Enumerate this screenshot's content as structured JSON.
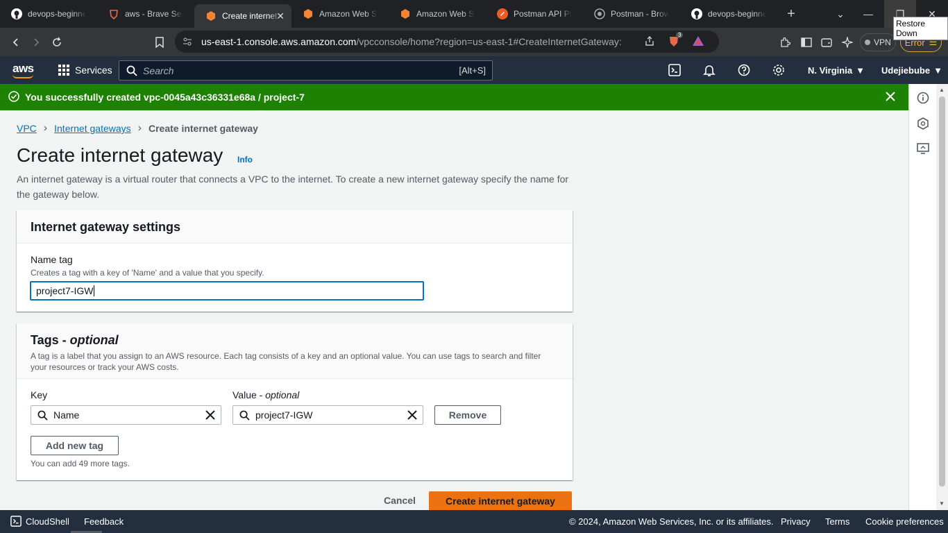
{
  "browser": {
    "tabs": [
      {
        "label": "devops-beginner",
        "icon": "github-icon"
      },
      {
        "label": "aws - Brave Search",
        "icon": "brave-icon"
      },
      {
        "label": "Create internet gateway",
        "icon": "aws-cube-icon",
        "active": true
      },
      {
        "label": "Amazon Web Services",
        "icon": "aws-cube-icon"
      },
      {
        "label": "Amazon Web Services",
        "icon": "aws-cube-icon"
      },
      {
        "label": "Postman API Platform",
        "icon": "postman-icon"
      },
      {
        "label": "Postman - Browser",
        "icon": "postman-icon"
      },
      {
        "label": "devops-beginner",
        "icon": "github-icon"
      }
    ],
    "url_host": "us-east-1.console.aws.amazon.com",
    "url_path": "/vpcconsole/home?region=us-east-1#CreateInternetGateway:",
    "vpn_label": "VPN",
    "error_label": "Error",
    "tooltip": "Restore Down",
    "brave_badge": "3"
  },
  "awsnav": {
    "logo": "aws",
    "services_label": "Services",
    "search_placeholder": "Search",
    "search_shortcut": "[Alt+S]",
    "region": "N. Virginia",
    "account": "Udejiebube"
  },
  "flash": {
    "message": "You successfully created vpc-0045a43c36331e68a / project-7"
  },
  "breadcrumb": {
    "vpc": "VPC",
    "igw": "Internet gateways",
    "current": "Create internet gateway"
  },
  "page": {
    "title": "Create internet gateway",
    "info": "Info",
    "description": "An internet gateway is a virtual router that connects a VPC to the internet. To create a new internet gateway specify the name for the gateway below."
  },
  "settings": {
    "heading": "Internet gateway settings",
    "name_label": "Name tag",
    "name_desc": "Creates a tag with a key of 'Name' and a value that you specify.",
    "name_value": "project7-IGW"
  },
  "tags": {
    "heading_main": "Tags - ",
    "heading_opt": "optional",
    "desc": "A tag is a label that you assign to an AWS resource. Each tag consists of a key and an optional value. You can use tags to search and filter your resources or track your AWS costs.",
    "key_label": "Key",
    "value_label_main": "Value - ",
    "value_label_opt": "optional",
    "rows": [
      {
        "key": "Name",
        "value": "project7-IGW"
      }
    ],
    "remove_label": "Remove",
    "add_label": "Add new tag",
    "limit_note": "You can add 49 more tags."
  },
  "actions": {
    "cancel": "Cancel",
    "create": "Create internet gateway"
  },
  "footer": {
    "cloudshell": "CloudShell",
    "feedback": "Feedback",
    "copyright": "© 2024, Amazon Web Services, Inc. or its affiliates.",
    "privacy": "Privacy",
    "terms": "Terms",
    "cookies": "Cookie preferences"
  },
  "colors": {
    "success": "#1d8102",
    "primary": "#ec7211",
    "nav": "#232f3e",
    "link": "#0073bb"
  }
}
